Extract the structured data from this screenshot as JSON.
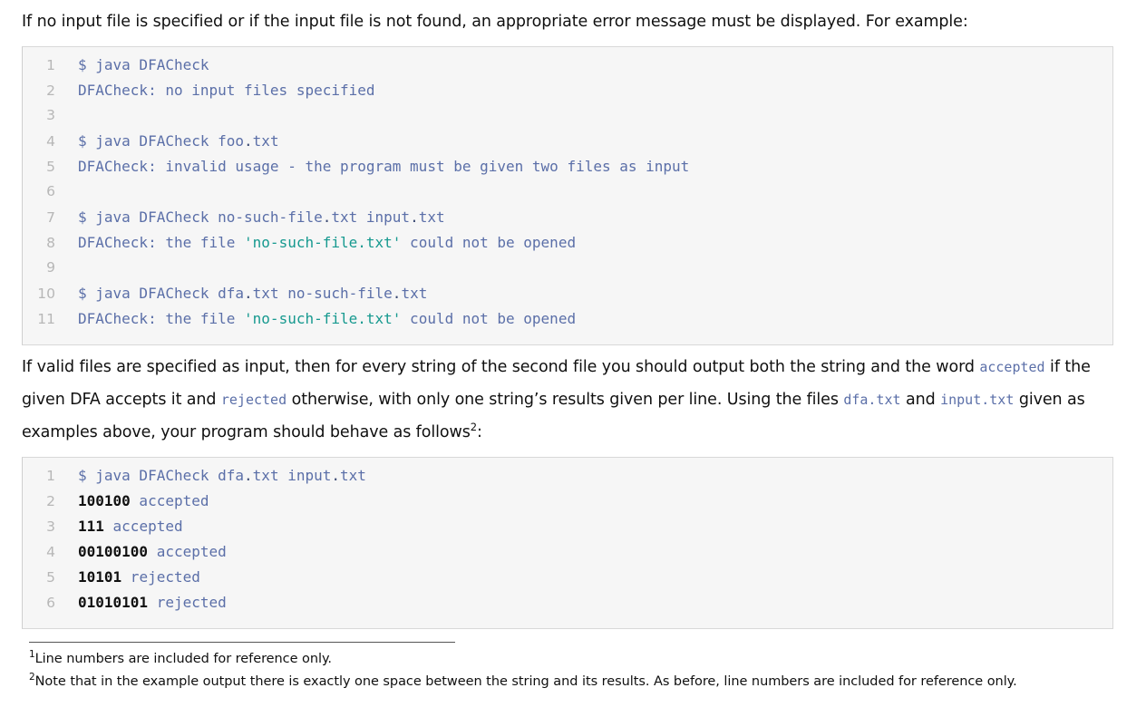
{
  "colors": {
    "code_text": "#5b6fa8",
    "code_string": "#16998f",
    "code_number": "#111111",
    "line_number": "#b7b7b7",
    "code_bg": "#f6f6f6",
    "code_border": "#d8d8d8",
    "prose_text": "#101010"
  },
  "paragraphs": {
    "intro": "If no input file is specified or if the input file is not found, an appropriate error message must be displayed. For example:",
    "body": {
      "part1": "If valid files are specified as input, then for every string of the second file you should output both the string and the word ",
      "code1": "accepted",
      "part2": " if the given DFA accepts it and ",
      "code2": "rejected",
      "part3": " otherwise, with only one string’s results given per line. Using the files ",
      "code3": "dfa.txt",
      "part4": " and ",
      "code4": "input.txt",
      "part5": " given as examples above, your program should behave as follows",
      "superscript": "2",
      "part6": ":"
    }
  },
  "code_blocks": [
    {
      "name": "error-examples",
      "lines": [
        {
          "n": "1",
          "segments": [
            {
              "text": "$ java DFACheck",
              "type": "plain"
            }
          ]
        },
        {
          "n": "2",
          "segments": [
            {
              "text": "DFACheck: no input files specified",
              "type": "plain"
            }
          ]
        },
        {
          "n": "3",
          "segments": [
            {
              "text": "",
              "type": "plain"
            }
          ]
        },
        {
          "n": "4",
          "segments": [
            {
              "text": "$ java DFACheck foo",
              "type": "plain"
            },
            {
              "text": ".",
              "type": "punct"
            },
            {
              "text": "txt",
              "type": "plain"
            }
          ]
        },
        {
          "n": "5",
          "segments": [
            {
              "text": "DFACheck: invalid usage - the program must be given two files as input",
              "type": "plain"
            }
          ]
        },
        {
          "n": "6",
          "segments": [
            {
              "text": "",
              "type": "plain"
            }
          ]
        },
        {
          "n": "7",
          "segments": [
            {
              "text": "$ java DFACheck no-such-file",
              "type": "plain"
            },
            {
              "text": ".",
              "type": "punct"
            },
            {
              "text": "txt input",
              "type": "plain"
            },
            {
              "text": ".",
              "type": "punct"
            },
            {
              "text": "txt",
              "type": "plain"
            }
          ]
        },
        {
          "n": "8",
          "segments": [
            {
              "text": "DFACheck: the file ",
              "type": "plain"
            },
            {
              "text": "'no-such-file.txt'",
              "type": "string"
            },
            {
              "text": " could not be opened",
              "type": "plain"
            }
          ]
        },
        {
          "n": "9",
          "segments": [
            {
              "text": "",
              "type": "plain"
            }
          ]
        },
        {
          "n": "10",
          "segments": [
            {
              "text": "$ java DFACheck dfa",
              "type": "plain"
            },
            {
              "text": ".",
              "type": "punct"
            },
            {
              "text": "txt no-such-file",
              "type": "plain"
            },
            {
              "text": ".",
              "type": "punct"
            },
            {
              "text": "txt",
              "type": "plain"
            }
          ]
        },
        {
          "n": "11",
          "segments": [
            {
              "text": "DFACheck: the file ",
              "type": "plain"
            },
            {
              "text": "'no-such-file.txt'",
              "type": "string"
            },
            {
              "text": " could not be opened",
              "type": "plain"
            }
          ]
        }
      ]
    },
    {
      "name": "expected-output",
      "lines": [
        {
          "n": "1",
          "segments": [
            {
              "text": "$ java DFACheck dfa",
              "type": "plain"
            },
            {
              "text": ".",
              "type": "punct"
            },
            {
              "text": "txt input",
              "type": "plain"
            },
            {
              "text": ".",
              "type": "punct"
            },
            {
              "text": "txt",
              "type": "plain"
            }
          ]
        },
        {
          "n": "2",
          "segments": [
            {
              "text": "100100",
              "type": "number"
            },
            {
              "text": " accepted",
              "type": "plain"
            }
          ]
        },
        {
          "n": "3",
          "segments": [
            {
              "text": "111",
              "type": "number"
            },
            {
              "text": " accepted",
              "type": "plain"
            }
          ]
        },
        {
          "n": "4",
          "segments": [
            {
              "text": "00100100",
              "type": "number"
            },
            {
              "text": " accepted",
              "type": "plain"
            }
          ]
        },
        {
          "n": "5",
          "segments": [
            {
              "text": "10101",
              "type": "number"
            },
            {
              "text": " rejected",
              "type": "plain"
            }
          ]
        },
        {
          "n": "6",
          "segments": [
            {
              "text": "01010101",
              "type": "number"
            },
            {
              "text": " rejected",
              "type": "plain"
            }
          ]
        }
      ]
    }
  ],
  "footnotes": [
    {
      "mark": "1",
      "text": "Line numbers are included for reference only."
    },
    {
      "mark": "2",
      "text": "Note that in the example output there is exactly one space between the string and its results. As before, line numbers are included for reference only."
    }
  ]
}
